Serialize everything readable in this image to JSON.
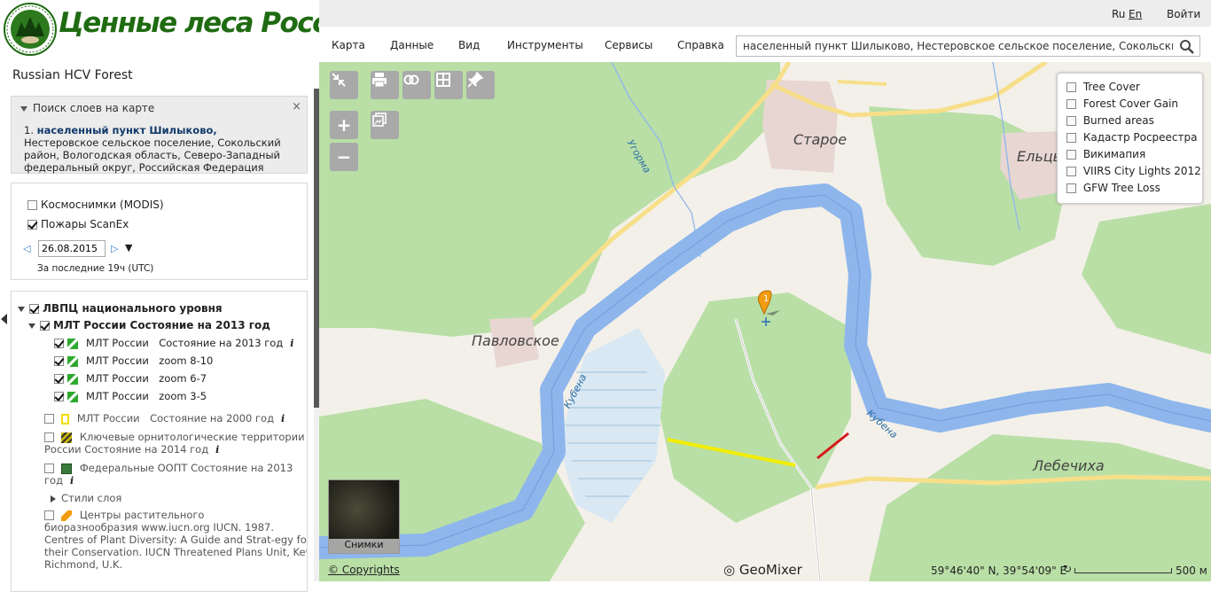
{
  "logo": {
    "brand": "Ценные леса России"
  },
  "app_title": "Russian HCV Forest",
  "header": {
    "lang_ru": "Ru",
    "lang_en": "En",
    "login": "Войти",
    "menu": [
      "Карта",
      "Данные",
      "Вид",
      "Инструменты",
      "Сервисы",
      "Справка"
    ],
    "search_value": "населенный пункт Шилыково, Нестеровское сельское поселение, Сокольский район"
  },
  "search_panel": {
    "title": "Поиск слоев на карте",
    "close": "×",
    "result_num": "1.",
    "result_bold": "населенный пункт Шилыково,",
    "result_rest": " Нестеровское сельское поселение, Сокольский район, Вологодская область, Северо-Западный федеральный округ, Российская Федерация"
  },
  "fires_panel": {
    "modis_label": "Космоснимки (MODIS)",
    "modis_checked": false,
    "fires_label": "Пожары ScanEx",
    "fires_checked": true,
    "date": "26.08.2015",
    "note": "За последние 19ч (UTC)"
  },
  "layers": {
    "group": "ЛВПЦ национального уровня",
    "subgroup": "МЛТ России Состояние на 2013 год",
    "items": [
      {
        "name": "МЛТ России",
        "desc": "Состояние на 2013 год",
        "info": "i"
      },
      {
        "name": "МЛТ России",
        "desc": "zoom 8-10"
      },
      {
        "name": "МЛТ России",
        "desc": "zoom 6-7"
      },
      {
        "name": "МЛТ России",
        "desc": "zoom 3-5"
      }
    ],
    "mlt2000": {
      "name": "МЛТ России",
      "desc": "Состояние на 2000 год",
      "info": "i"
    },
    "birds": {
      "line1": "Ключевые орнитологические территории",
      "line2": "России   Состояние на 2014 год",
      "info": "i"
    },
    "oopt": {
      "line1": "Федеральные ООПТ   Состояние на 2013",
      "line2": "год",
      "info": "i"
    },
    "styles": "Стили слоя",
    "plants": {
      "line1": "Центры растительного",
      "line2": "биоразнообразия   www.iucn.org IUCN. 1987.",
      "line3": "Centres of Plant Diversity: A Guide and Strat-egy for",
      "line4": "their Conservation. IUCN Threatened Plans Unit, Kew,",
      "line5": "Richmond, U.K."
    }
  },
  "legend": {
    "items": [
      "Tree Cover",
      "Forest Cover Gain",
      "Burned areas",
      "Кадастр Росреестра",
      "Викимапия",
      "VIIRS City Lights 2012",
      "GFW Tree Loss"
    ]
  },
  "map": {
    "places": [
      "Старое",
      "Ельцыно",
      "Павловское",
      "Лебечиха"
    ],
    "rivers": [
      "Угорма",
      "Кубена",
      "Кубена"
    ],
    "marker_num": "1",
    "snapshots": "Снимки",
    "copyright": "© Copyrights",
    "provider": "GeoMixer",
    "coords": "59°46'40\" N, 39°54'09\" E",
    "scale": "500 м",
    "colors": {
      "forest": "#b9dfa6",
      "land": "#f3f0e9",
      "river": "#8eb6ec",
      "road": "#f7df8a",
      "built": "#e7d6d1"
    }
  }
}
